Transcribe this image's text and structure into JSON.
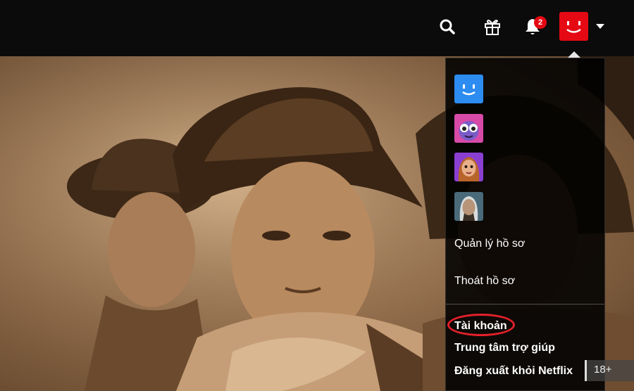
{
  "header": {
    "search_icon": "search-icon",
    "gift_icon": "gift-icon",
    "bell_icon": "bell-icon",
    "notification_count": "2",
    "avatar_icon": "smiley-avatar-icon",
    "caret_icon": "caret-down-icon"
  },
  "dropdown": {
    "profiles": [
      {
        "icon": "blue-smiley-avatar"
      },
      {
        "icon": "purple-creature-avatar"
      },
      {
        "icon": "animated-girl-avatar"
      },
      {
        "icon": "witcher-avatar"
      }
    ],
    "manage_profiles": "Quản lý hồ sơ",
    "exit_profile": "Thoát hồ sơ",
    "account": "Tài khoản",
    "help_center": "Trung tâm trợ giúp",
    "sign_out": "Đăng xuất khỏi Netflix"
  },
  "hero": {
    "maturity_rating": "18+"
  },
  "colors": {
    "brand_red": "#e50914",
    "highlight_circle": "#e3202a",
    "topbar": "#0b0b0b"
  }
}
